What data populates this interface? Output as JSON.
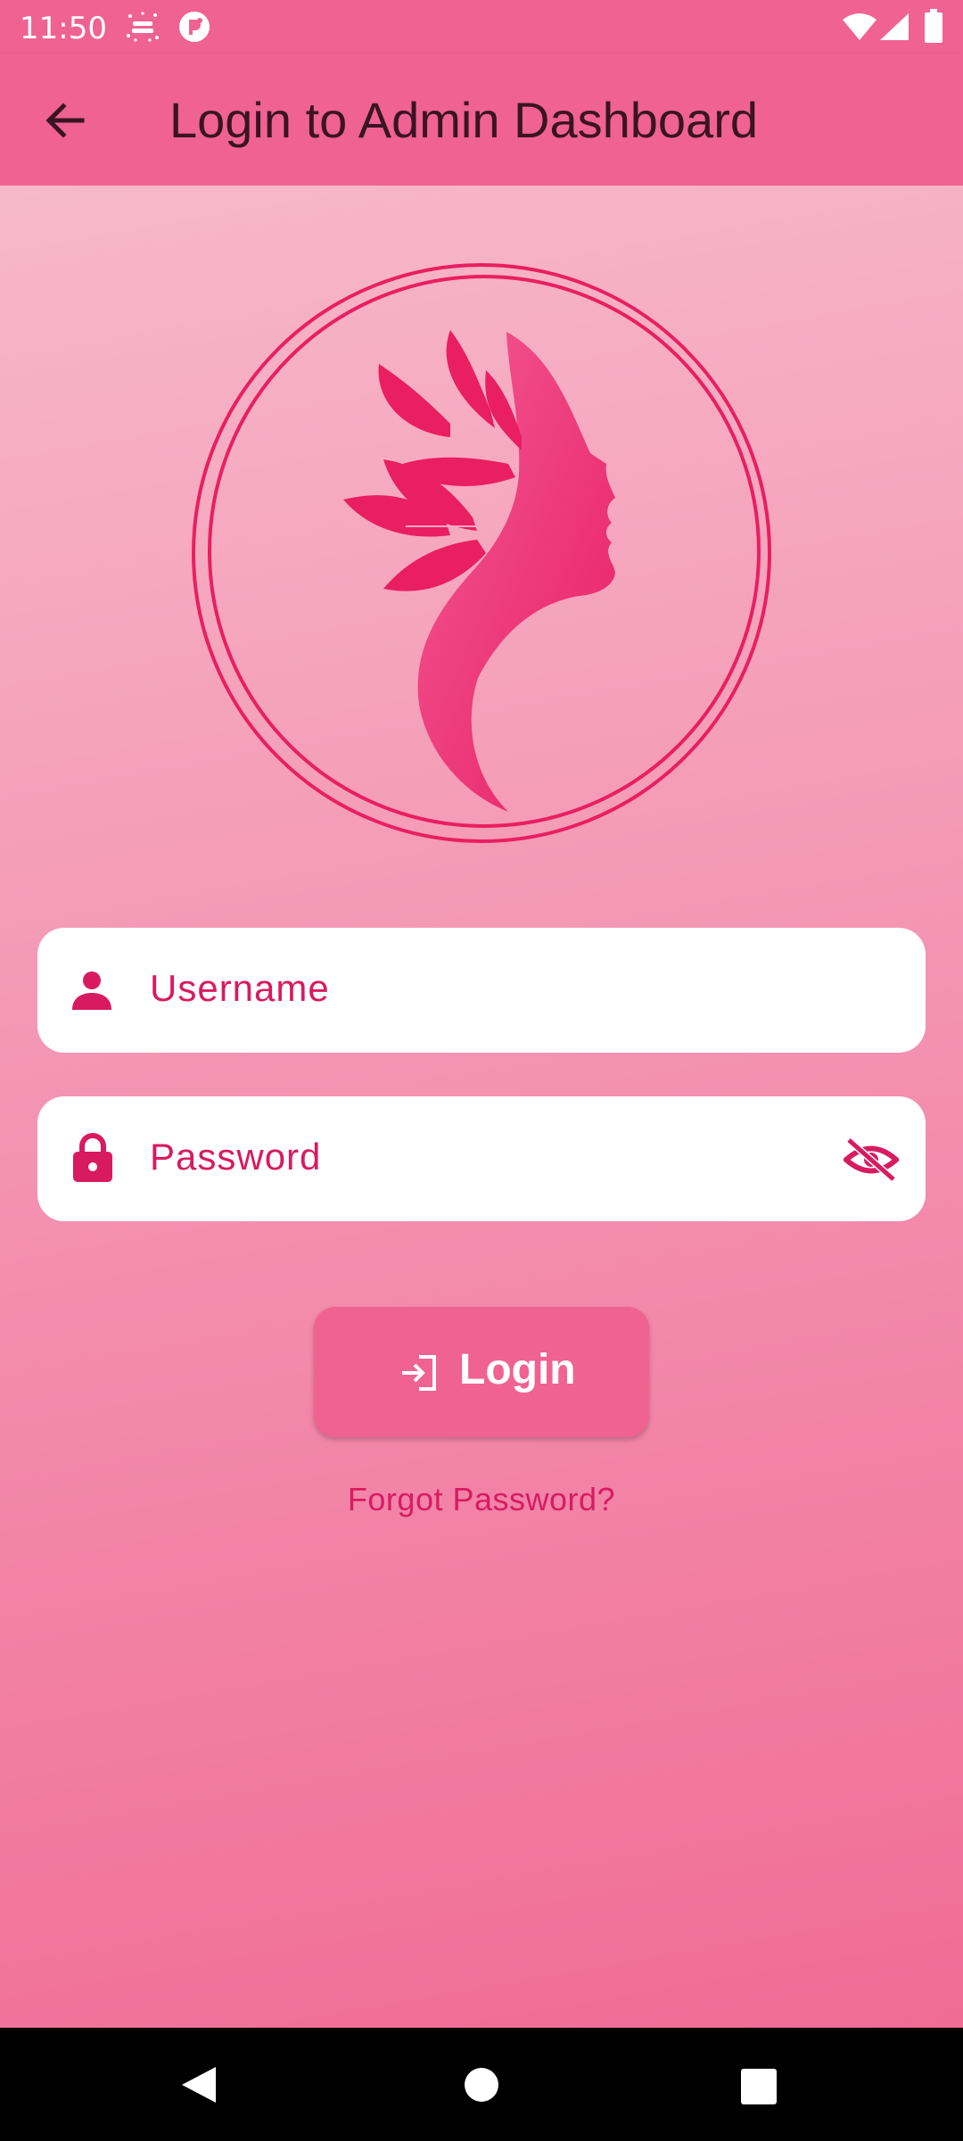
{
  "status_bar": {
    "time": "11:50",
    "icons": [
      "birthday-notification-icon",
      "app-notification-icon",
      "wifi-icon",
      "cellular-signal-icon",
      "battery-icon"
    ]
  },
  "app_bar": {
    "title": "Login to Admin Dashboard",
    "back_icon": "arrow-back-icon"
  },
  "logo": {
    "description_icon": "woman-profile-leaves-logo",
    "color": "#e91e63"
  },
  "form": {
    "username_label": "Username",
    "username_icon": "person-icon",
    "password_label": "Password",
    "password_icon": "lock-icon",
    "visibility_icon": "visibility-off-icon"
  },
  "actions": {
    "login_label": "Login",
    "login_icon": "login-icon",
    "forgot_label": "Forgot Password?"
  },
  "nav_bar": {
    "icons": [
      "back-triangle-icon",
      "home-circle-icon",
      "recents-square-icon"
    ]
  },
  "colors": {
    "primary": "#f06292",
    "accent": "#d81b60",
    "field_bg": "#ffffff",
    "nav_bg": "#000000"
  }
}
